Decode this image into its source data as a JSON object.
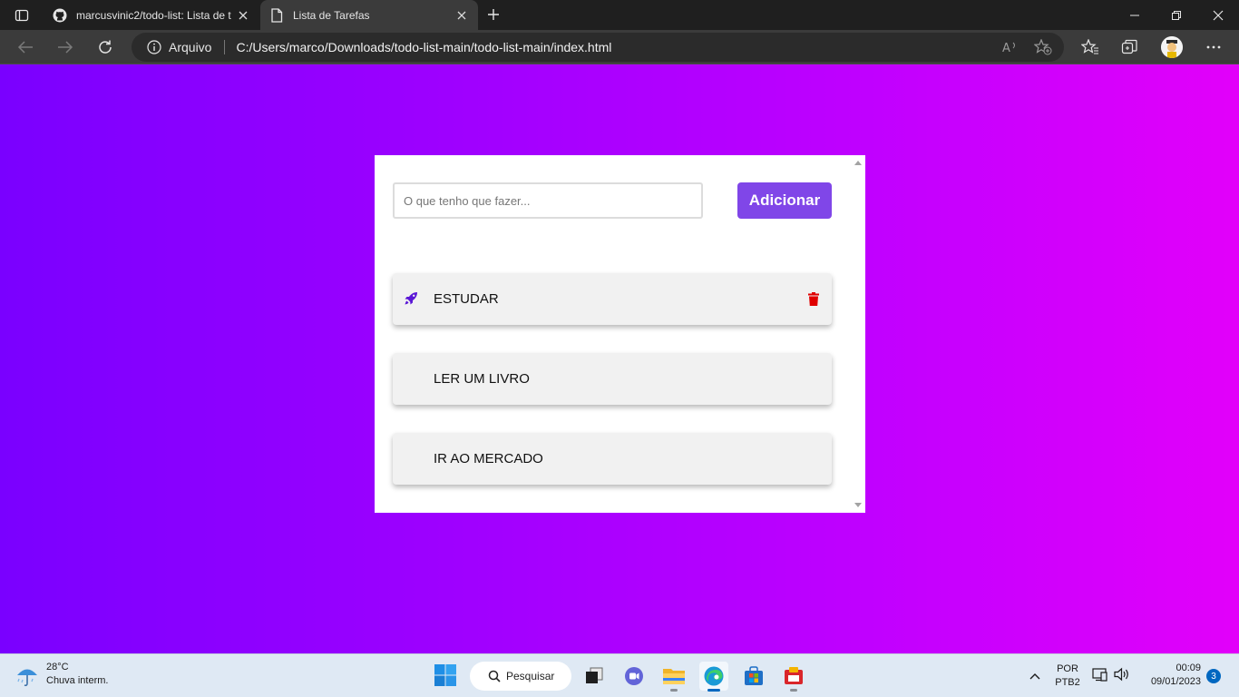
{
  "browser": {
    "tabs": [
      {
        "title": "marcusvinic2/todo-list: Lista de t",
        "icon": "github-icon",
        "active": false
      },
      {
        "title": "Lista de Tarefas",
        "icon": "page-icon",
        "active": true
      }
    ],
    "address": {
      "scheme_label": "Arquivo",
      "url": "C:/Users/marco/Downloads/todo-list-main/todo-list-main/index.html"
    }
  },
  "app": {
    "input_placeholder": "O que tenho que fazer...",
    "add_button_label": "Adicionar",
    "tasks": [
      {
        "text": "ESTUDAR",
        "icon": "rocket-icon",
        "has_delete": true
      },
      {
        "text": "LER UM LIVRO"
      },
      {
        "text": "IR AO MERCADO"
      }
    ],
    "colors": {
      "accent": "#8046e8",
      "rocket": "#5a17d6",
      "trash": "#e00000"
    }
  },
  "taskbar": {
    "weather": {
      "temp": "28°C",
      "desc": "Chuva interm."
    },
    "search_label": "Pesquisar",
    "lang": {
      "line1": "POR",
      "line2": "PTB2"
    },
    "clock": {
      "time": "00:09",
      "date": "09/01/2023"
    },
    "notification_count": "3"
  }
}
